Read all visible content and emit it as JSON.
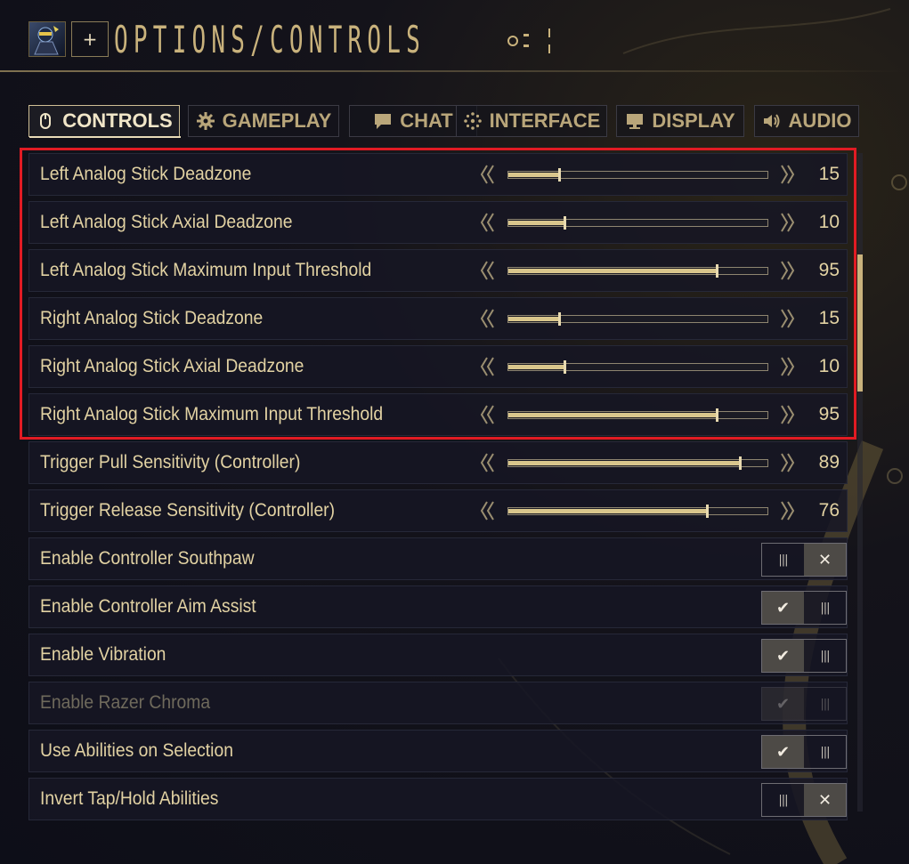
{
  "header": {
    "title": "OPTIONS/CONTROLS",
    "add_label": "+"
  },
  "tabs": [
    {
      "label": "CONTROLS",
      "icon": "mouse-icon",
      "active": true
    },
    {
      "label": "GAMEPLAY",
      "icon": "gear-icon",
      "active": false
    },
    {
      "label": "CHAT",
      "icon": "chat-bubble-icon",
      "active": false
    },
    {
      "label": "INTERFACE",
      "icon": "interface-icon",
      "active": false
    },
    {
      "label": "DISPLAY",
      "icon": "monitor-icon",
      "active": false
    },
    {
      "label": "AUDIO",
      "icon": "speaker-icon",
      "active": false
    }
  ],
  "settings": [
    {
      "label": "Left Analog Stick Deadzone",
      "type": "slider",
      "value": 15,
      "level": 0.195
    },
    {
      "label": "Left Analog Stick Axial Deadzone",
      "type": "slider",
      "value": 10,
      "level": 0.218
    },
    {
      "label": "Left Analog Stick Maximum Input Threshold",
      "type": "slider",
      "value": 95,
      "level": 0.805
    },
    {
      "label": "Right Analog Stick Deadzone",
      "type": "slider",
      "value": 15,
      "level": 0.195
    },
    {
      "label": "Right Analog Stick Axial Deadzone",
      "type": "slider",
      "value": 10,
      "level": 0.218
    },
    {
      "label": "Right Analog Stick Maximum Input Threshold",
      "type": "slider",
      "value": 95,
      "level": 0.805
    },
    {
      "label": "Trigger Pull Sensitivity (Controller)",
      "type": "slider",
      "value": 89,
      "level": 0.895
    },
    {
      "label": "Trigger Release Sensitivity (Controller)",
      "type": "slider",
      "value": 76,
      "level": 0.765
    },
    {
      "label": "Enable Controller Southpaw",
      "type": "toggle",
      "checked": false
    },
    {
      "label": "Enable Controller Aim Assist",
      "type": "toggle",
      "checked": true
    },
    {
      "label": "Enable Vibration",
      "type": "toggle",
      "checked": true
    },
    {
      "label": "Enable Razer Chroma",
      "type": "toggle",
      "checked": true,
      "disabled": true
    },
    {
      "label": "Use Abilities on Selection",
      "type": "toggle",
      "checked": true
    },
    {
      "label": "Invert Tap/Hold Abilities",
      "type": "toggle",
      "checked": false
    }
  ],
  "colors": {
    "accent": "#d9c68c",
    "highlight": "#e11b23",
    "text": "#e2d2a3"
  }
}
